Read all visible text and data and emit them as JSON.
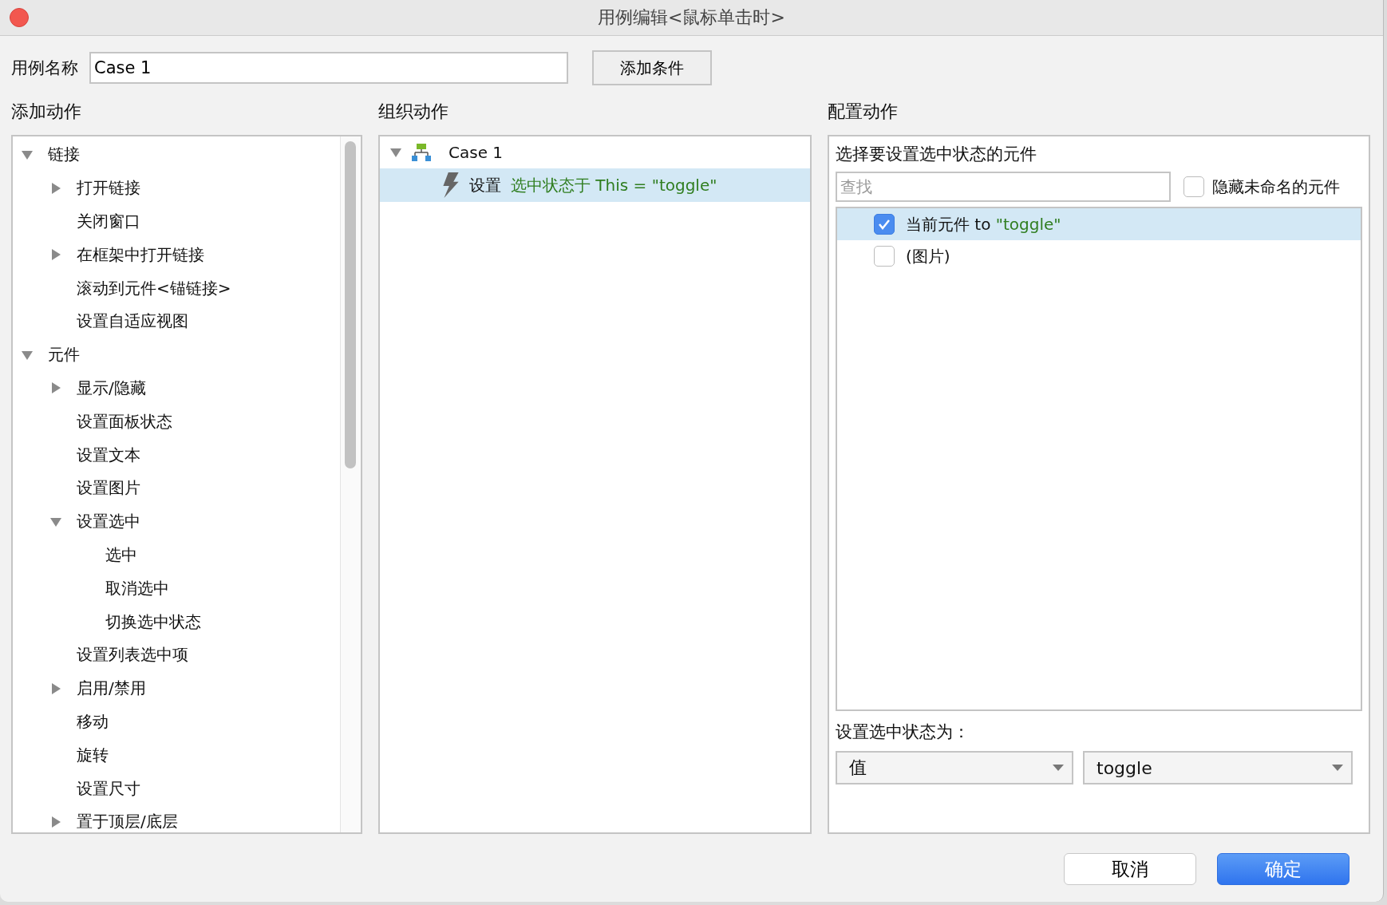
{
  "window": {
    "title": "用例编辑<鼠标单击时>"
  },
  "case_name": {
    "label": "用例名称",
    "value": "Case 1"
  },
  "add_condition_button": "添加条件",
  "add_actions": {
    "heading": "添加动作",
    "tree": [
      {
        "label": "链接",
        "expanded": true,
        "children": [
          {
            "label": "打开链接",
            "expanded": false
          },
          {
            "label": "关闭窗口"
          },
          {
            "label": "在框架中打开链接",
            "expanded": false
          },
          {
            "label": "滚动到元件<锚链接>"
          },
          {
            "label": "设置自适应视图"
          }
        ]
      },
      {
        "label": "元件",
        "expanded": true,
        "children": [
          {
            "label": "显示/隐藏",
            "expanded": false
          },
          {
            "label": "设置面板状态"
          },
          {
            "label": "设置文本"
          },
          {
            "label": "设置图片"
          },
          {
            "label": "设置选中",
            "expanded": true,
            "children": [
              {
                "label": "选中"
              },
              {
                "label": "取消选中"
              },
              {
                "label": "切换选中状态"
              }
            ]
          },
          {
            "label": "设置列表选中项"
          },
          {
            "label": "启用/禁用",
            "expanded": false
          },
          {
            "label": "移动"
          },
          {
            "label": "旋转"
          },
          {
            "label": "设置尺寸"
          },
          {
            "label": "置于顶层/底层",
            "expanded": false
          }
        ]
      }
    ]
  },
  "organize_actions": {
    "heading": "组织动作",
    "cases": [
      {
        "label": "Case 1",
        "expanded": true,
        "actions": [
          {
            "verb": "设置",
            "detail": "选中状态于 This = \"toggle\"",
            "selected": true
          }
        ]
      }
    ]
  },
  "configure_action": {
    "heading": "配置动作",
    "subheading": "选择要设置选中状态的元件",
    "search": {
      "placeholder": "查找"
    },
    "hide_unnamed": {
      "label": "隐藏未命名的元件",
      "checked": false
    },
    "widgets": [
      {
        "label": "当前元件",
        "connector": "to",
        "value": "\"toggle\"",
        "checked": true,
        "selected": true
      },
      {
        "label": "(图片)",
        "checked": false,
        "selected": false
      }
    ],
    "state_label": "设置选中状态为：",
    "state_mode": "值",
    "state_value": "toggle"
  },
  "buttons": [
    {
      "label": "取消",
      "kind": "secondary"
    },
    {
      "label": "确定",
      "kind": "primary"
    }
  ]
}
